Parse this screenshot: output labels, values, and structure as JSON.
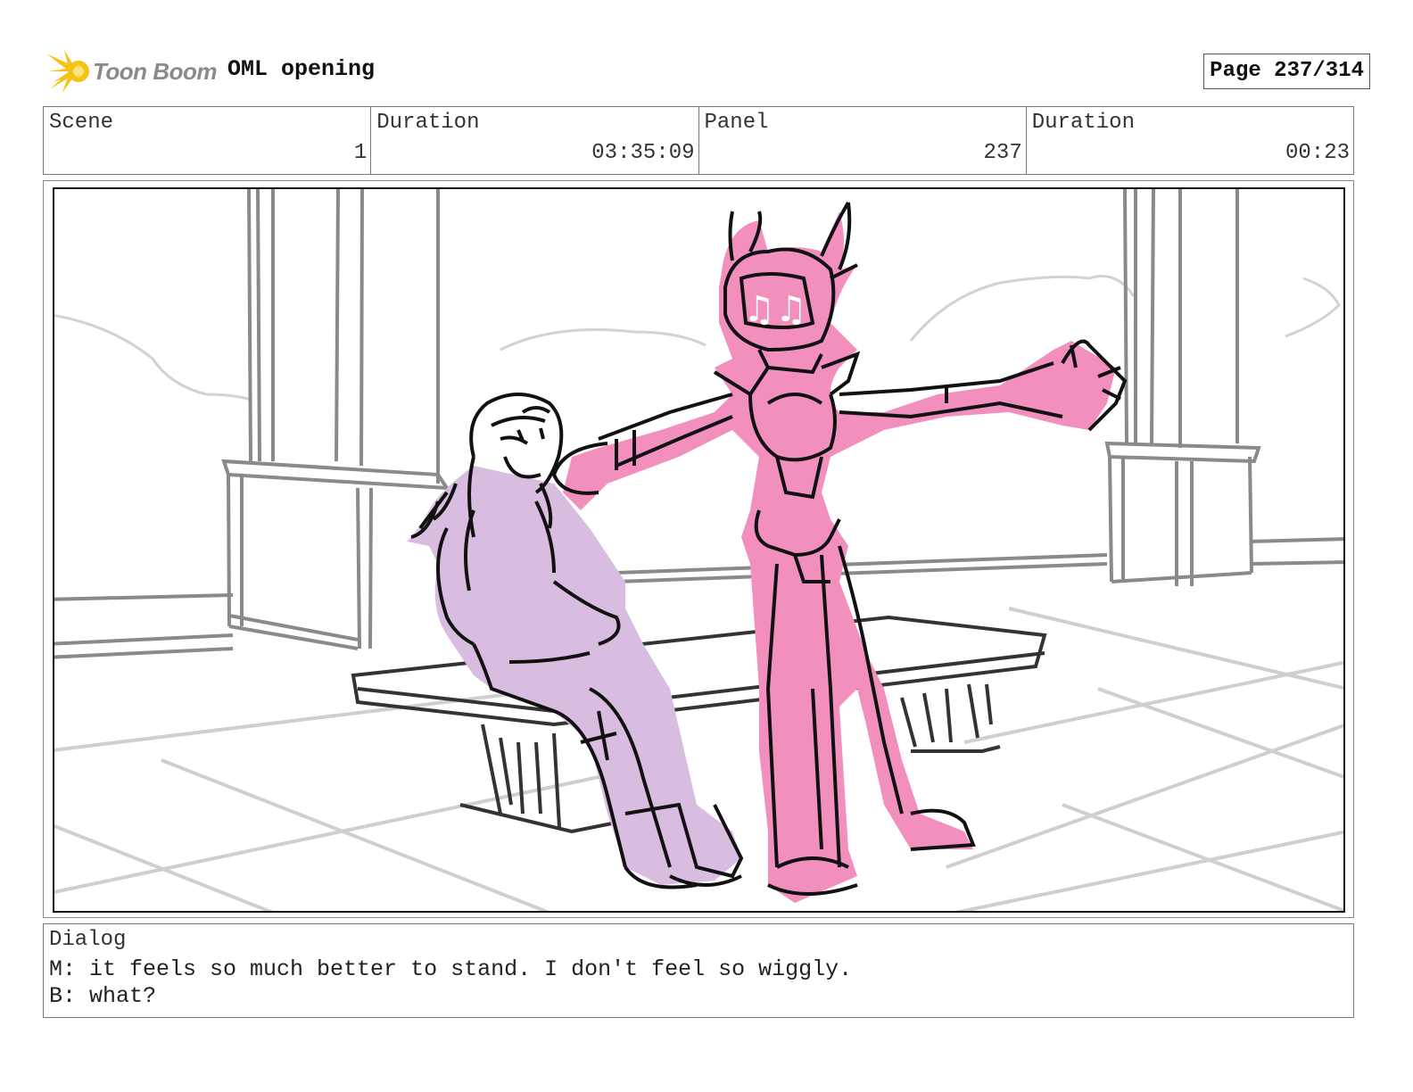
{
  "header": {
    "brand": "Toon Boom",
    "brand_logo_icon": "starburst-icon",
    "project_title": "OML opening",
    "page_label": "Page 237/314"
  },
  "info": {
    "scene_label": "Scene",
    "scene_value": "1",
    "scene_duration_label": "Duration",
    "scene_duration_value": "03:35:09",
    "panel_label": "Panel",
    "panel_value": "237",
    "panel_duration_label": "Duration",
    "panel_duration_value": "00:23"
  },
  "colors": {
    "robot_fill": "#f28fbd",
    "girl_fill": "#d9bde0",
    "scenery_line": "#8a8a8a",
    "ink": "#111111",
    "logo_yellow": "#f5c316"
  },
  "dialog": {
    "label": "Dialog",
    "lines": [
      "M: it feels so much better to stand. I don't feel so wiggly.",
      "B: what?"
    ]
  }
}
